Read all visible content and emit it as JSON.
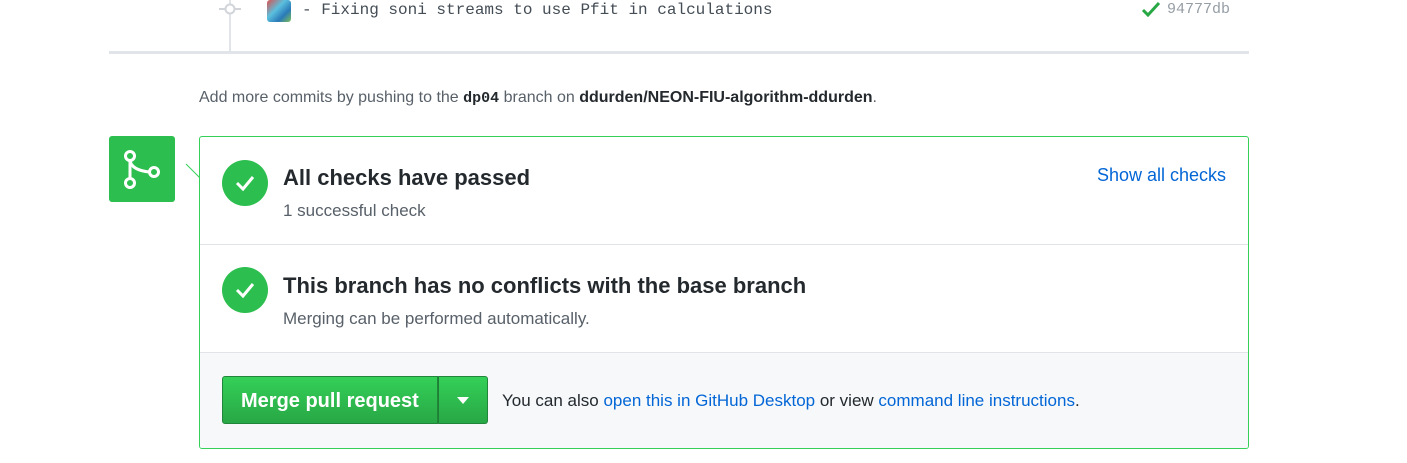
{
  "commit": {
    "message": "- Fixing soni streams to use Pfit in calculations",
    "sha": "94777db",
    "status_color": "#28a745"
  },
  "push_note": {
    "prefix": "Add more commits by pushing to the ",
    "branch": "dp04",
    "middle": " branch on ",
    "repo": "ddurden/NEON-FIU-algorithm-ddurden",
    "suffix": "."
  },
  "merge_icon": "git-merge-icon",
  "checks": {
    "title": "All checks have passed",
    "subtitle": "1 successful check",
    "show_all_label": "Show all checks",
    "icon": "check-icon"
  },
  "conflicts": {
    "title": "This branch has no conflicts with the base branch",
    "subtitle": "Merging can be performed automatically.",
    "icon": "check-icon"
  },
  "merge": {
    "button_label": "Merge pull request",
    "dropdown_icon": "caret-down-icon",
    "also_prefix": "You can also ",
    "desktop_link": "open this in GitHub Desktop",
    "or_view": " or view ",
    "cli_link": "command line instructions",
    "suffix": "."
  },
  "colors": {
    "success": "#2cbe4e",
    "link": "#0366d6",
    "card_border": "#34d058"
  }
}
